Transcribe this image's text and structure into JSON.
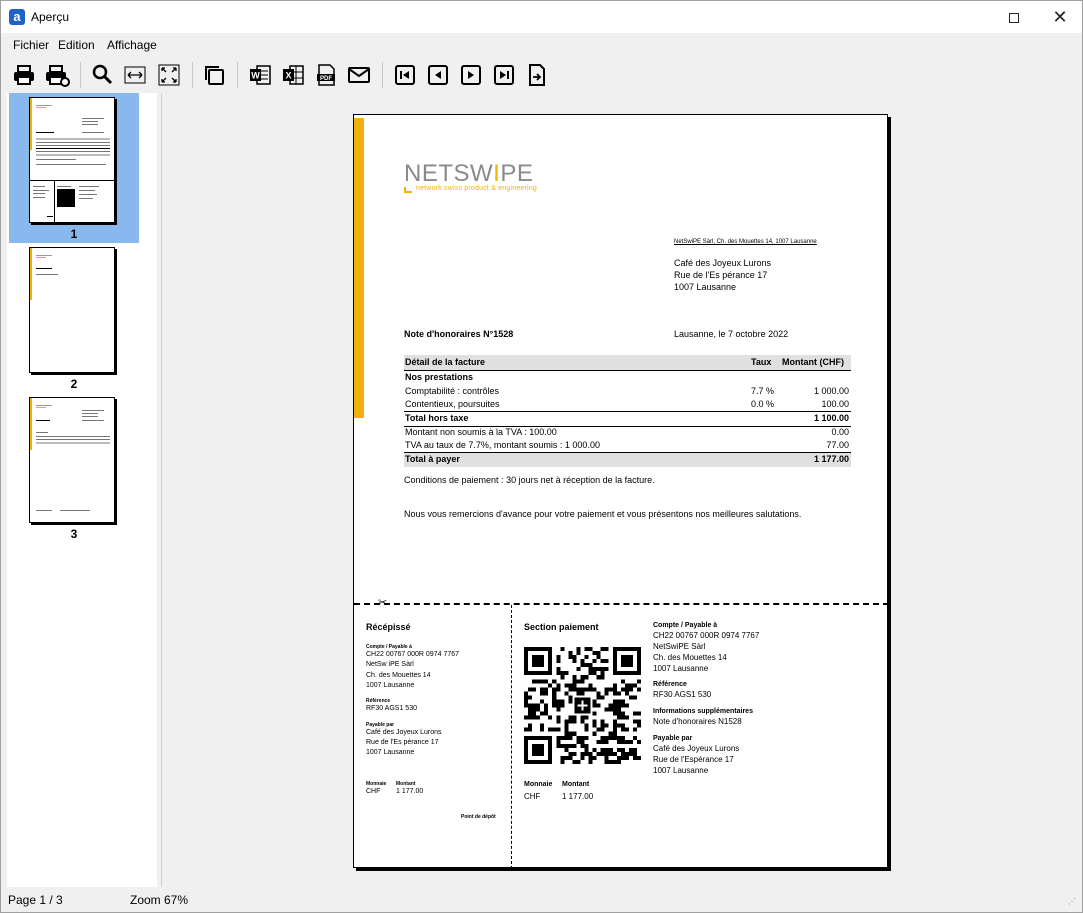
{
  "window": {
    "title": "Aperçu",
    "app_icon_letter": "a"
  },
  "menu": [
    "Fichier",
    "Edition",
    "Affichage"
  ],
  "toolbar": [
    "print",
    "print-setup",
    "zoom",
    "fit-width",
    "fit-page",
    "copy",
    "export-word",
    "export-excel",
    "export-pdf",
    "email",
    "first-page",
    "previous-page",
    "next-page",
    "last-page",
    "go-to-page"
  ],
  "thumbnails": [
    {
      "label": "1",
      "selected": true
    },
    {
      "label": "2",
      "selected": false
    },
    {
      "label": "3",
      "selected": false
    }
  ],
  "document": {
    "logo": "NETSWiPE",
    "logo_tagline": "network swiss product & engineering",
    "sender_line": "NetSwiPE Sàrl, Ch. des Mouettes 14, 1007 Lausanne",
    "recipient": [
      "Café des Joyeux Lurons",
      "Rue de l'Es pérance 17",
      "1007 Lausanne"
    ],
    "invoice_title": "Note d'honoraires N°1528",
    "place_date": "Lausanne, le 7 octobre 2022",
    "table": {
      "header": {
        "label": "Détail de la facture",
        "rate": "Taux",
        "amount": "Montant (CHF)"
      },
      "section": "Nos prestations",
      "rows": [
        {
          "label": "Comptabilité : contrôles",
          "rate": "7.7 %",
          "amount": "1 000.00"
        },
        {
          "label": "Contentieux, poursuites",
          "rate": "0.0 %",
          "amount": "100.00"
        }
      ],
      "subtotal": {
        "label": "Total hors taxe",
        "amount": "1 100.00"
      },
      "tax_rows": [
        {
          "label": "Montant non soumis à la TVA : 100.00",
          "amount": "0.00"
        },
        {
          "label": "TVA au taux de 7.7%, montant soumis : 1 000.00",
          "amount": "77.00"
        }
      ],
      "total": {
        "label": "Total à payer",
        "amount": "1 177.00"
      }
    },
    "conditions": "Conditions de paiement : 30 jours net à réception de la facture.",
    "closing": "Nous vous remercions d'avance pour votre paiement et vous présentons nos meilleures salutations.",
    "receipt": {
      "title": "Récépissé",
      "account_label": "Compte / Payable à",
      "account": [
        "CH22 00767 000R 0974 7767",
        "NetSw iPE Sàrl",
        "Ch. des Mouettes 14",
        "1007 Lausanne"
      ],
      "reference_label": "Référence",
      "reference": "RF30 AGS1 530",
      "payable_by_label": "Payable par",
      "payable_by": [
        "Café des Joyeux Lurons",
        "Rue de l'Es pérance 17",
        "1007 Lausanne"
      ],
      "currency_label": "Monnaie",
      "amount_label": "Montant",
      "currency": "CHF",
      "amount": "1 177.00",
      "acceptance_point": "Point de dépôt"
    },
    "payment": {
      "title": "Section paiement",
      "account_label": "Compte / Payable à",
      "account": [
        "CH22 00767 000R 0974 7767",
        "NetSwiPE Sàrl",
        "Ch. des Mouettes 14",
        "1007 Lausanne"
      ],
      "reference_label": "Référence",
      "reference": "RF30 AGS1 530",
      "info_label": "Informations supplémentaires",
      "info": "Note d'honoraires N1528",
      "payable_by_label": "Payable par",
      "payable_by": [
        "Café des Joyeux Lurons",
        "Rue de l'Espérance 17",
        "1007 Lausanne"
      ],
      "currency_label": "Monnaie",
      "amount_label": "Montant",
      "currency": "CHF",
      "amount": "1 177.00"
    }
  },
  "status": {
    "page": "Page 1 / 3",
    "zoom": "Zoom 67%"
  },
  "colors": {
    "accent": "#f2b10a",
    "selection": "#89b8ee",
    "app_icon": "#1d63c7"
  }
}
